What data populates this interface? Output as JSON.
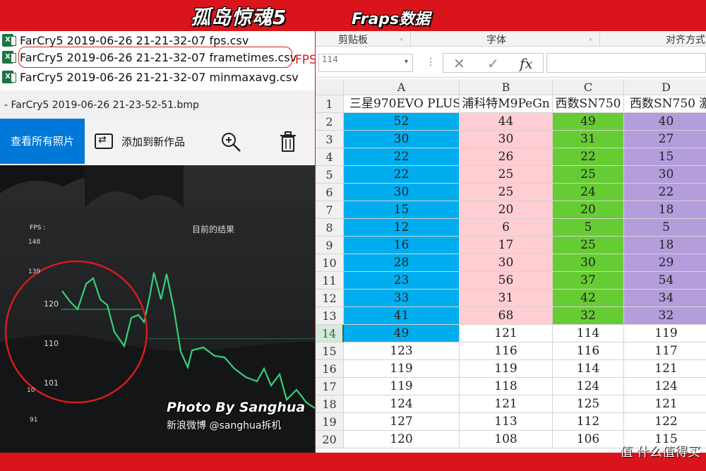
{
  "banner": {
    "title": "孤岛惊魂5",
    "subtitle": "Fraps数据"
  },
  "files": [
    {
      "icon": "excel-icon",
      "name": "FarCry5 2019-06-26 21-21-32-07 fps.csv"
    },
    {
      "icon": "excel-icon",
      "name": "FarCry5 2019-06-26 21-21-32-07 frametimes.csv"
    },
    {
      "icon": "excel-icon",
      "name": "FarCry5 2019-06-26 21-21-32-07 minmaxavg.csv"
    }
  ],
  "annotation": "FPS生成时间",
  "viewer": {
    "title": "- FarCry5 2019-06-26 21-23-52-51.bmp",
    "view_all": "查看所有照片",
    "add_to_new": "添加到新作品",
    "zoom_icon": "zoom-in-icon",
    "delete_icon": "trash-icon"
  },
  "overlay": {
    "title": "目前的结果",
    "fps_label": "FPS :",
    "ticks": [
      "148",
      "139",
      "120",
      "110",
      "101",
      "10",
      "91"
    ]
  },
  "watermark": {
    "line1": "Photo By Sanghua",
    "line2": "新浪微博 @sanghua拆机"
  },
  "spreadsheet": {
    "ribbon": [
      "剪贴板",
      "字体",
      "对齐方式"
    ],
    "namebox": "114",
    "formula_icons": [
      "✕",
      "✓",
      "fx"
    ],
    "columns": [
      "A",
      "B",
      "C",
      "D"
    ],
    "headers": [
      "三星970EVO PLUS",
      "浦科特M9PeGn",
      "西数SN750",
      "西数SN750 激"
    ],
    "rows": [
      [
        "52",
        "44",
        "49",
        "40"
      ],
      [
        "30",
        "30",
        "31",
        "27"
      ],
      [
        "22",
        "26",
        "22",
        "15"
      ],
      [
        "22",
        "25",
        "25",
        "30"
      ],
      [
        "30",
        "25",
        "24",
        "22"
      ],
      [
        "15",
        "20",
        "20",
        "18"
      ],
      [
        "12",
        "6",
        "5",
        "5"
      ],
      [
        "16",
        "17",
        "25",
        "18"
      ],
      [
        "28",
        "30",
        "30",
        "29"
      ],
      [
        "23",
        "56",
        "37",
        "54"
      ],
      [
        "33",
        "31",
        "42",
        "34"
      ],
      [
        "41",
        "68",
        "32",
        "32"
      ],
      [
        "49",
        "121",
        "114",
        "119"
      ],
      [
        "123",
        "116",
        "116",
        "117"
      ],
      [
        "119",
        "119",
        "114",
        "121"
      ],
      [
        "119",
        "118",
        "124",
        "124"
      ],
      [
        "124",
        "121",
        "125",
        "121"
      ],
      [
        "127",
        "113",
        "112",
        "122"
      ],
      [
        "120",
        "108",
        "106",
        "115"
      ]
    ],
    "active_row": "14",
    "colors": {
      "A": "#00aeef",
      "B": "#ffcdd2",
      "C": "#66cc33",
      "D": "#b39ddb"
    }
  },
  "footer_logo": "值 什么值得买"
}
